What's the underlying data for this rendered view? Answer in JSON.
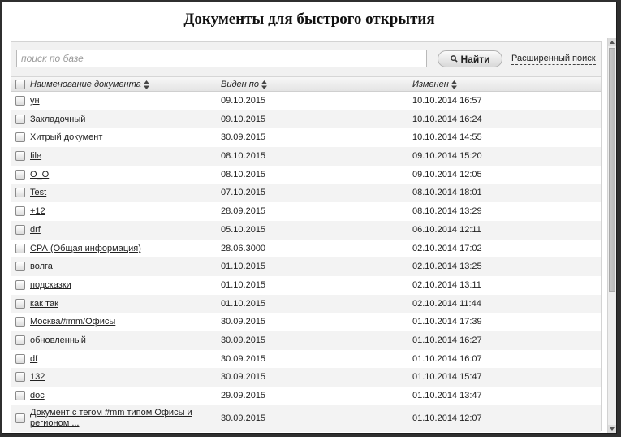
{
  "title": "Документы для быстрого открытия",
  "search": {
    "placeholder": "поиск по базе",
    "find_label": "Найти",
    "advanced_label": "Расширенный поиск"
  },
  "columns": {
    "name": "Наименование документа",
    "seen": "Виден по",
    "modified": "Изменен"
  },
  "rows": [
    {
      "name": "ун",
      "seen": "09.10.2015",
      "modified": "10.10.2014 16:57"
    },
    {
      "name": "Закладочный",
      "seen": "09.10.2015",
      "modified": "10.10.2014 16:24"
    },
    {
      "name": "Хитрый документ",
      "seen": "30.09.2015",
      "modified": "10.10.2014 14:55"
    },
    {
      "name": "file",
      "seen": "08.10.2015",
      "modified": "09.10.2014 15:20"
    },
    {
      "name": "О_О",
      "seen": "08.10.2015",
      "modified": "09.10.2014 12:05"
    },
    {
      "name": "Test",
      "seen": "07.10.2015",
      "modified": "08.10.2014 18:01"
    },
    {
      "name": "+12",
      "seen": "28.09.2015",
      "modified": "08.10.2014 13:29"
    },
    {
      "name": "drf",
      "seen": "05.10.2015",
      "modified": "06.10.2014 12:11"
    },
    {
      "name": "СРА (Общая информация)",
      "seen": "28.06.3000",
      "modified": "02.10.2014 17:02"
    },
    {
      "name": "волга",
      "seen": "01.10.2015",
      "modified": "02.10.2014 13:25"
    },
    {
      "name": "подсказки",
      "seen": "01.10.2015",
      "modified": "02.10.2014 13:11"
    },
    {
      "name": "как так",
      "seen": "01.10.2015",
      "modified": "02.10.2014 11:44"
    },
    {
      "name": "Москва/#mm/Офисы",
      "seen": "30.09.2015",
      "modified": "01.10.2014 17:39"
    },
    {
      "name": "обновленный",
      "seen": "30.09.2015",
      "modified": "01.10.2014 16:27"
    },
    {
      "name": "df",
      "seen": "30.09.2015",
      "modified": "01.10.2014 16:07"
    },
    {
      "name": "132",
      "seen": "30.09.2015",
      "modified": "01.10.2014 15:47"
    },
    {
      "name": "doc",
      "seen": "29.09.2015",
      "modified": "01.10.2014 13:47"
    },
    {
      "name": "Документ с тегом #mm типом Офисы и регионом ...",
      "seen": "30.09.2015",
      "modified": "01.10.2014 12:07"
    }
  ]
}
